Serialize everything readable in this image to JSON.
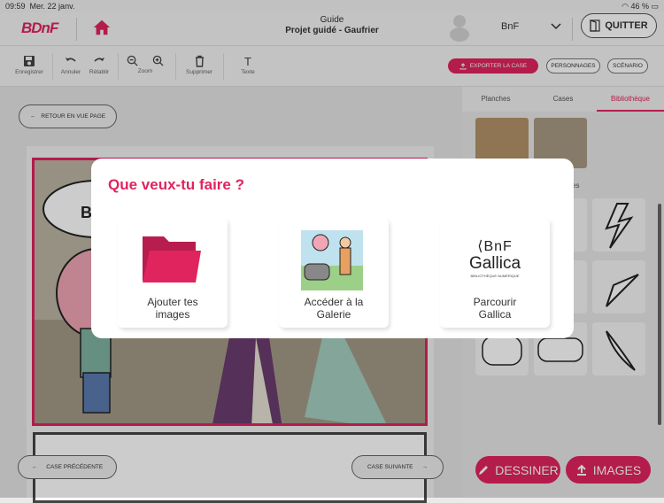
{
  "status": {
    "time": "09:59",
    "date": "Mer. 22 janv.",
    "battery": "46 %"
  },
  "header": {
    "logo": "BDnF",
    "title_line1": "Guide",
    "title_line2": "Projet guidé - Gaufrier",
    "user": "BnF",
    "quit_label": "QUITTER"
  },
  "toolbar": {
    "save": "Enregistrer",
    "undo": "Annuler",
    "redo": "Rétablir",
    "zoom": "Zoom",
    "delete": "Supprimer",
    "text": "Texte",
    "text_icon": "T",
    "export": "EXPORTER LA CASE",
    "characters": "PERSONNAGES",
    "scenario": "SCÉNARIO"
  },
  "main": {
    "back": "RETOUR EN VUE PAGE",
    "prev": "CASE PRÉCÉDENTE",
    "next": "CASE SUIVANTE",
    "bubble_text": "Bo"
  },
  "sidebar": {
    "tabs": [
      {
        "label": "Planches"
      },
      {
        "label": "Cases"
      },
      {
        "label": "Bibliothèque"
      }
    ],
    "partial_label": "es"
  },
  "bottom": {
    "draw": "DESSINER",
    "images": "IMAGES"
  },
  "modal": {
    "title": "Que veux-tu faire ?",
    "options": [
      {
        "line1": "Ajouter tes",
        "line2": "images"
      },
      {
        "line1": "Accéder à la",
        "line2": "Galerie"
      },
      {
        "line1": "Parcourir",
        "line2": "Gallica"
      }
    ],
    "gallica": {
      "brand": "BnF",
      "name": "Gallica",
      "tagline": "BIBLIOTHÈQUE NUMÉRIQUE"
    }
  },
  "colors": {
    "accent": "#e0245e"
  }
}
